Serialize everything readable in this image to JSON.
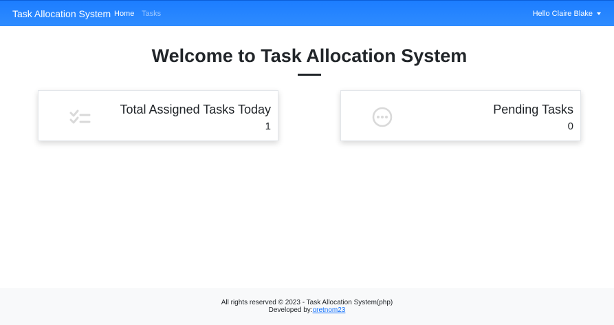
{
  "navbar": {
    "brand": "Task Allocation System",
    "links": [
      {
        "label": "Home"
      },
      {
        "label": "Tasks"
      }
    ],
    "user_greeting": "Hello Claire Blake"
  },
  "main": {
    "title": "Welcome to Task Allocation System",
    "cards": [
      {
        "title": "Total Assigned Tasks Today",
        "value": "1",
        "icon": "checklist-icon"
      },
      {
        "title": "Pending Tasks",
        "value": "0",
        "icon": "pending-icon"
      }
    ]
  },
  "footer": {
    "copyright": "All rights reserved © 2023 - Task Allocation System(php)",
    "developed_by": "Developed by:",
    "developer_link": "oretnom23"
  },
  "colors": {
    "navbar": "#1c7dff",
    "footer_bg": "#f8f9fa",
    "link": "#0d6efd",
    "icon": "#d9d9d9"
  }
}
